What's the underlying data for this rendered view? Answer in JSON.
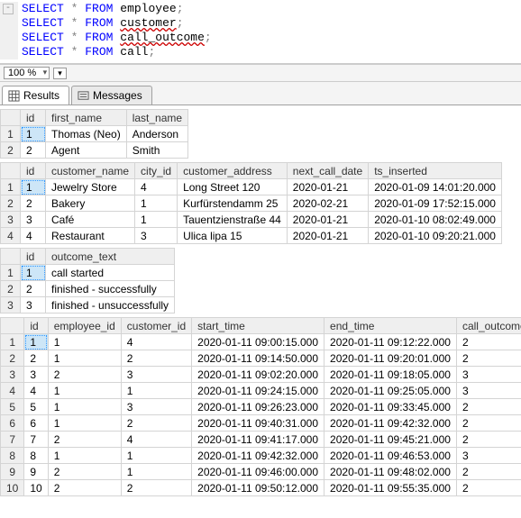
{
  "sql": {
    "lines": [
      {
        "kw1": "SELECT",
        "star": "*",
        "kw2": "FROM",
        "ident": "employee",
        "semi": ";",
        "squiggle": false
      },
      {
        "kw1": "SELECT",
        "star": "*",
        "kw2": "FROM",
        "ident": "customer",
        "semi": ";",
        "squiggle": true
      },
      {
        "kw1": "SELECT",
        "star": "*",
        "kw2": "FROM",
        "ident": "call_outcome",
        "semi": ";",
        "squiggle": true
      },
      {
        "kw1": "SELECT",
        "star": "*",
        "kw2": "FROM",
        "ident": "call",
        "semi": ";",
        "squiggle": false
      }
    ],
    "collapse_glyph": "⊟"
  },
  "zoom": {
    "value": "100 %",
    "extra": "▾"
  },
  "tabs": {
    "results": "Results",
    "messages": "Messages"
  },
  "employee": {
    "headers": [
      "id",
      "first_name",
      "last_name"
    ],
    "rows": [
      {
        "n": "1",
        "id": "1",
        "first_name": "Thomas (Neo)",
        "last_name": "Anderson"
      },
      {
        "n": "2",
        "id": "2",
        "first_name": "Agent",
        "last_name": "Smith"
      }
    ]
  },
  "customer": {
    "headers": [
      "id",
      "customer_name",
      "city_id",
      "customer_address",
      "next_call_date",
      "ts_inserted"
    ],
    "rows": [
      {
        "n": "1",
        "id": "1",
        "customer_name": "Jewelry Store",
        "city_id": "4",
        "customer_address": "Long Street 120",
        "next_call_date": "2020-01-21",
        "ts_inserted": "2020-01-09 14:01:20.000"
      },
      {
        "n": "2",
        "id": "2",
        "customer_name": "Bakery",
        "city_id": "1",
        "customer_address": "Kurfürstendamm 25",
        "next_call_date": "2020-02-21",
        "ts_inserted": "2020-01-09 17:52:15.000"
      },
      {
        "n": "3",
        "id": "3",
        "customer_name": "Café",
        "city_id": "1",
        "customer_address": "Tauentzienstraße 44",
        "next_call_date": "2020-01-21",
        "ts_inserted": "2020-01-10 08:02:49.000"
      },
      {
        "n": "4",
        "id": "4",
        "customer_name": "Restaurant",
        "city_id": "3",
        "customer_address": "Ulica lipa 15",
        "next_call_date": "2020-01-21",
        "ts_inserted": "2020-01-10 09:20:21.000"
      }
    ]
  },
  "outcome": {
    "headers": [
      "id",
      "outcome_text"
    ],
    "rows": [
      {
        "n": "1",
        "id": "1",
        "outcome_text": "call started"
      },
      {
        "n": "2",
        "id": "2",
        "outcome_text": "finished - successfully"
      },
      {
        "n": "3",
        "id": "3",
        "outcome_text": "finished - unsuccessfully"
      }
    ]
  },
  "call": {
    "headers": [
      "id",
      "employee_id",
      "customer_id",
      "start_time",
      "end_time",
      "call_outcome_id"
    ],
    "rows": [
      {
        "n": "1",
        "id": "1",
        "employee_id": "1",
        "customer_id": "4",
        "start_time": "2020-01-11 09:00:15.000",
        "end_time": "2020-01-11 09:12:22.000",
        "call_outcome_id": "2"
      },
      {
        "n": "2",
        "id": "2",
        "employee_id": "1",
        "customer_id": "2",
        "start_time": "2020-01-11 09:14:50.000",
        "end_time": "2020-01-11 09:20:01.000",
        "call_outcome_id": "2"
      },
      {
        "n": "3",
        "id": "3",
        "employee_id": "2",
        "customer_id": "3",
        "start_time": "2020-01-11 09:02:20.000",
        "end_time": "2020-01-11 09:18:05.000",
        "call_outcome_id": "3"
      },
      {
        "n": "4",
        "id": "4",
        "employee_id": "1",
        "customer_id": "1",
        "start_time": "2020-01-11 09:24:15.000",
        "end_time": "2020-01-11 09:25:05.000",
        "call_outcome_id": "3"
      },
      {
        "n": "5",
        "id": "5",
        "employee_id": "1",
        "customer_id": "3",
        "start_time": "2020-01-11 09:26:23.000",
        "end_time": "2020-01-11 09:33:45.000",
        "call_outcome_id": "2"
      },
      {
        "n": "6",
        "id": "6",
        "employee_id": "1",
        "customer_id": "2",
        "start_time": "2020-01-11 09:40:31.000",
        "end_time": "2020-01-11 09:42:32.000",
        "call_outcome_id": "2"
      },
      {
        "n": "7",
        "id": "7",
        "employee_id": "2",
        "customer_id": "4",
        "start_time": "2020-01-11 09:41:17.000",
        "end_time": "2020-01-11 09:45:21.000",
        "call_outcome_id": "2"
      },
      {
        "n": "8",
        "id": "8",
        "employee_id": "1",
        "customer_id": "1",
        "start_time": "2020-01-11 09:42:32.000",
        "end_time": "2020-01-11 09:46:53.000",
        "call_outcome_id": "3"
      },
      {
        "n": "9",
        "id": "9",
        "employee_id": "2",
        "customer_id": "1",
        "start_time": "2020-01-11 09:46:00.000",
        "end_time": "2020-01-11 09:48:02.000",
        "call_outcome_id": "2"
      },
      {
        "n": "10",
        "id": "10",
        "employee_id": "2",
        "customer_id": "2",
        "start_time": "2020-01-11 09:50:12.000",
        "end_time": "2020-01-11 09:55:35.000",
        "call_outcome_id": "2"
      }
    ]
  }
}
